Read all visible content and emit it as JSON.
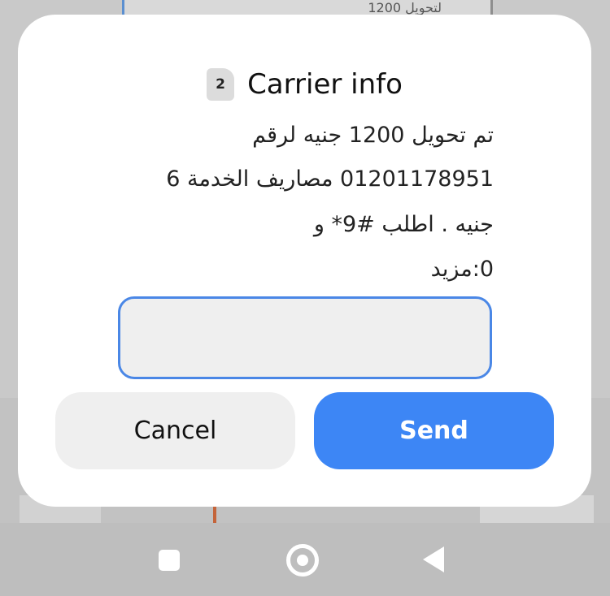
{
  "background": {
    "bubble_text": "لتحويل 1200"
  },
  "dialog": {
    "sim_badge": "2",
    "title": "Carrier info",
    "message_lines": [
      "تم تحويل 1200 جنيه لرقم",
      "01201178951 مصاريف الخدمة 6",
      "جنيه . اطلب #9* و",
      "0:مزيد"
    ],
    "input_value": "",
    "cancel_label": "Cancel",
    "send_label": "Send"
  },
  "navbar": {
    "recent_icon": "square-icon",
    "home_icon": "circle-icon",
    "back_icon": "triangle-icon"
  },
  "colors": {
    "accent": "#3d86f5",
    "input_border": "#4a87e6"
  }
}
